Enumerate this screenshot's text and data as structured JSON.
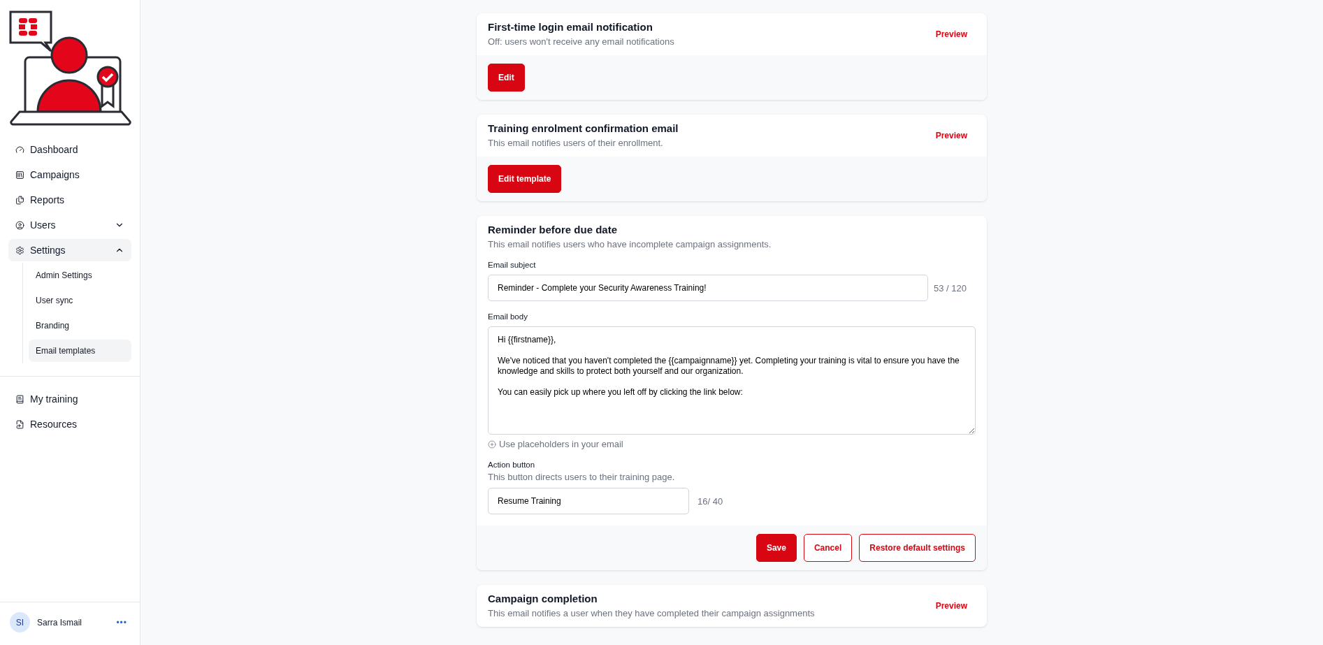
{
  "sidebar": {
    "nav": [
      {
        "label": "Dashboard",
        "selected": false
      },
      {
        "label": "Campaigns",
        "selected": false
      },
      {
        "label": "Reports",
        "selected": false
      },
      {
        "label": "Users",
        "selected": false,
        "expanded": false
      },
      {
        "label": "Settings",
        "selected": true,
        "expanded": true,
        "children": [
          {
            "label": "Admin Settings",
            "selected": false
          },
          {
            "label": "User sync",
            "selected": false
          },
          {
            "label": "Branding",
            "selected": false
          },
          {
            "label": "Email templates",
            "selected": true
          }
        ]
      }
    ],
    "secondary_nav": [
      {
        "label": "My training",
        "selected": false
      },
      {
        "label": "Resources",
        "selected": false
      }
    ],
    "user": {
      "initials": "SI",
      "name": "Sarra Ismail",
      "menu": "•••"
    }
  },
  "cards": [
    {
      "kind": "summary",
      "title": "First-time login email notification",
      "description": "Off: users won't receive any email notifications",
      "preview": "Preview",
      "action": "Edit"
    },
    {
      "kind": "summary",
      "title": "Training enrolment confirmation email",
      "description": "This email notifies users of their enrollment.",
      "preview": "Preview",
      "action": "Edit template"
    },
    {
      "kind": "editor",
      "title": "Reminder before due date",
      "description": "This email notifies users who have incomplete campaign assignments.",
      "subject": {
        "label": "Email subject",
        "value": "Reminder - Complete your Security Awareness Training!",
        "counter": "53 / 120"
      },
      "body": {
        "label": "Email body",
        "value": "Hi {{firstname}},\n\nWe've noticed that you haven't completed the {{campaignname}} yet. Completing your training is vital to ensure you have the knowledge and skills to protect both yourself and our organization.\n\nYou can easily pick up where you left off by clicking the link below:"
      },
      "placeholders_link": "Use placeholders in your email",
      "action_button": {
        "label": "Action button",
        "hint": "This button directs users to their training page.",
        "value": "Resume Training",
        "counter": "16/ 40"
      },
      "buttons": [
        {
          "kind": "primary",
          "label": "Save"
        },
        {
          "kind": "outline",
          "label": "Cancel"
        },
        {
          "kind": "outline",
          "label": "Restore default settings"
        }
      ]
    },
    {
      "kind": "summary",
      "title": "Campaign completion",
      "description": "This email notifies a user when they have completed their campaign assignments",
      "preview": "Preview"
    }
  ]
}
